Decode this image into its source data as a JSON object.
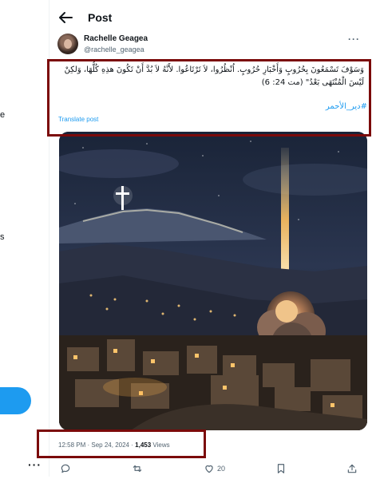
{
  "sidebar": {
    "fragment_1": "e",
    "fragment_2": "s",
    "more_label": "···"
  },
  "header": {
    "title": "Post",
    "back_icon": "arrow-left-icon"
  },
  "post": {
    "author_name": "Rachelle Geagea",
    "author_handle": "@rachelle_geagea",
    "more_label": "···",
    "text": "وَسَوْفَ تَسْمَعُونَ بِحُرُوبٍ وَأَخْبَارِ حُرُوبٍ. اُنْظُرُوا، لاَ تَرْتَاعُوا. لأَنَّهُ لاَ بُدَّ أَنْ تَكُونَ هذِهِ كُلُّهَا، وَلكِنْ لَيْسَ الْمُنْتَهَى بَعْدُ\" (مت 24: 6)",
    "hashtag": "#دير_الأحمر",
    "translate_label": "Translate post",
    "time": "12:58 PM",
    "date": "Sep 24, 2024",
    "separator": "·",
    "views_count": "1,453",
    "views_label": "Views"
  },
  "actions": {
    "reply_icon": "reply-icon",
    "repost_icon": "repost-icon",
    "like_icon": "heart-icon",
    "like_count": "20",
    "bookmark_icon": "bookmark-icon",
    "share_icon": "share-icon"
  },
  "colors": {
    "accent": "#1d9bf0",
    "highlight_border": "#7b0a0a",
    "secondary_text": "#536471"
  }
}
